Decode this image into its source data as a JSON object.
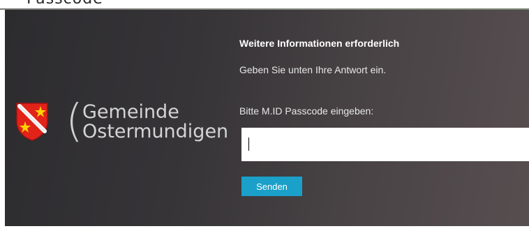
{
  "top": {
    "clipped_text": "Passcode"
  },
  "logo": {
    "name_line1": "Gemeinde",
    "name_line2": "Ostermundigen",
    "crest_colors": {
      "shield": "#e2231a",
      "stars": "#ffd200",
      "bar": "#ffffff",
      "outline": "#a01212"
    }
  },
  "form": {
    "title": "Weitere Informationen erforderlich",
    "subtitle": "Geben Sie unten Ihre Antwort ein.",
    "field_label": "Bitte M.ID Passcode eingeben:",
    "input_value": "",
    "submit_label": "Senden"
  },
  "colors": {
    "accent": "#1aa0c9",
    "panel_dark": "#2c2b2e",
    "panel_light": "#574e50"
  }
}
